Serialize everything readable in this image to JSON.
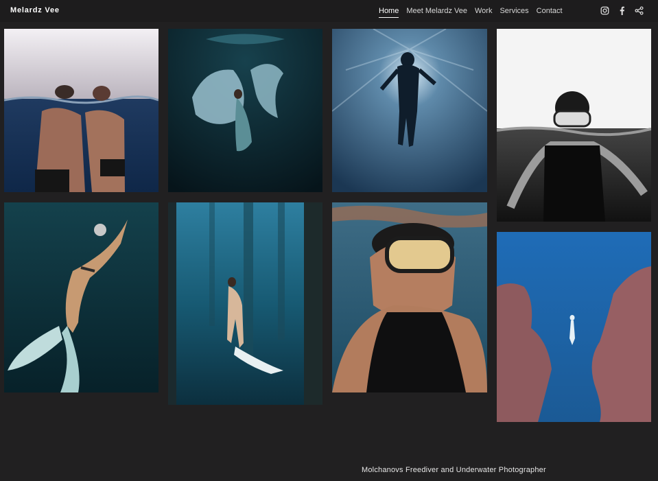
{
  "header": {
    "brand": "Melardz Vee",
    "nav": [
      "Home",
      "Meet Melardz Vee",
      "Work",
      "Services",
      "Contact"
    ],
    "active_nav": "Home",
    "social_icons": [
      "instagram-icon",
      "facebook-icon",
      "share-icon"
    ]
  },
  "gallery": {
    "photos": [
      "couple-at-surface",
      "woman-in-flowing-dress",
      "silhouette-in-sunburst",
      "black-and-white-mask-portrait",
      "diver-with-monofin",
      "diver-between-pier-pilings",
      "selfie-with-mask",
      "diver-between-coral-walls"
    ]
  },
  "footer": {
    "tagline": "Molchanovs Freediver and Underwater Photographer"
  },
  "colors": {
    "background": "#212021",
    "accent": "#ffffff"
  }
}
